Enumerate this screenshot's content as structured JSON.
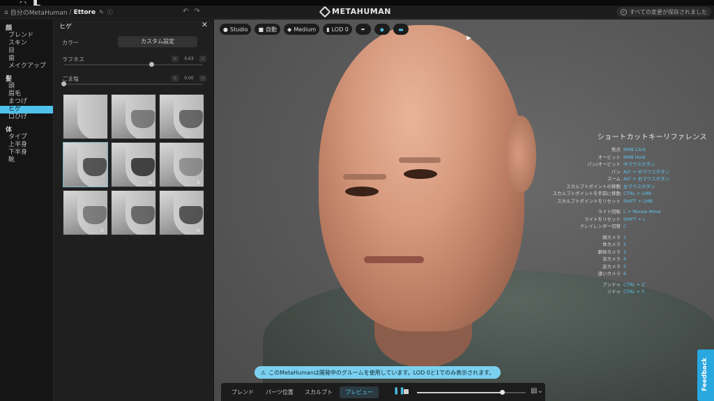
{
  "header": {
    "breadcrumb_root": "自分のMetaHuman",
    "breadcrumb_sep": "/",
    "breadcrumb_current": "Ettore",
    "app_name": "METAHUMAN",
    "save_status": "すべての変更が保存されました"
  },
  "nav": {
    "groups": [
      {
        "title": "顔",
        "items": [
          "ブレンド",
          "スキン",
          "目",
          "歯",
          "メイクアップ"
        ]
      },
      {
        "title": "髪",
        "items": [
          "頭",
          "眉毛",
          "まつげ",
          "ヒゲ",
          "口ひげ"
        ]
      },
      {
        "title": "体",
        "items": [
          "タイプ",
          "上半身",
          "下半身",
          "靴"
        ]
      }
    ],
    "active_item": "ヒゲ"
  },
  "panel": {
    "title": "ヒゲ",
    "color_label": "カラー",
    "color_button": "カスタム設定",
    "roughness_label": "ラフネス",
    "roughness_value": "0.63",
    "roughness_level": 0.63,
    "salt_pepper_label": "ごま塩",
    "salt_pepper_value": "0.00",
    "salt_pepper_level": 0.0,
    "thumbnails": [
      {
        "selected": false,
        "warning": false,
        "beard": false
      },
      {
        "selected": false,
        "warning": false,
        "beard": true
      },
      {
        "selected": false,
        "warning": false,
        "beard": true
      },
      {
        "selected": true,
        "warning": false,
        "beard": true
      },
      {
        "selected": false,
        "warning": true,
        "beard": true
      },
      {
        "selected": false,
        "warning": true,
        "beard": true
      },
      {
        "selected": false,
        "warning": true,
        "beard": true
      },
      {
        "selected": false,
        "warning": false,
        "beard": true
      },
      {
        "selected": false,
        "warning": true,
        "beard": true
      }
    ]
  },
  "toolbar": {
    "studio": "Studio",
    "auto": "自動",
    "quality": "Medium",
    "lod": "LOD 0"
  },
  "shortcuts": {
    "title": "ショートカットキーリファレンス",
    "groups": [
      [
        {
          "k": "焦点",
          "v": "RMB Click"
        },
        {
          "k": "オービット",
          "v": "RMB Hold"
        },
        {
          "k": "パン/オービット",
          "v": "中マウスボタン"
        },
        {
          "k": "パン",
          "v": "ALT + 中マウスボタン"
        },
        {
          "k": "ズーム",
          "v": "ALT + 右マウスボタン"
        },
        {
          "k": "スカルプトポイントの移動",
          "v": "左マウスボタン"
        },
        {
          "k": "スカルプトポイントを手前に移動",
          "v": "CTRL + LMB"
        },
        {
          "k": "スカルプトポイントをリセット",
          "v": "SHIFT + LMB"
        }
      ],
      [
        {
          "k": "ライト回転",
          "v": "L + Mouse Move"
        },
        {
          "k": "ライトをリセット",
          "v": "SHIFT + L"
        },
        {
          "k": "クレイレンダー切替",
          "v": "C"
        }
      ],
      [
        {
          "k": "顔カメラ",
          "v": "1"
        },
        {
          "k": "体カメラ",
          "v": "2"
        },
        {
          "k": "胴体カメラ",
          "v": "3"
        },
        {
          "k": "足カメラ",
          "v": "4"
        },
        {
          "k": "足カメラ",
          "v": "5"
        },
        {
          "k": "遠いカメラ",
          "v": "6"
        }
      ],
      [
        {
          "k": "アンドゥ",
          "v": "CTRL + Z"
        },
        {
          "k": "リドゥ",
          "v": "CTRL + Y"
        }
      ]
    ]
  },
  "notice": "このMetaHumanは開発中のグルームを使用しています。LOD 0と1でのみ表示されます。",
  "bottom_tabs": [
    {
      "label": "ブレンド",
      "active": false
    },
    {
      "label": "パーツ位置",
      "active": false
    },
    {
      "label": "スカルプト",
      "active": false
    },
    {
      "label": "プレビュー",
      "active": true
    }
  ],
  "playback_progress": 0.78,
  "feedback": "Feedback",
  "colors": {
    "accent": "#4fc1ea",
    "notice_bg": "#7cd0ef",
    "feedback_bg": "#29a7df"
  }
}
